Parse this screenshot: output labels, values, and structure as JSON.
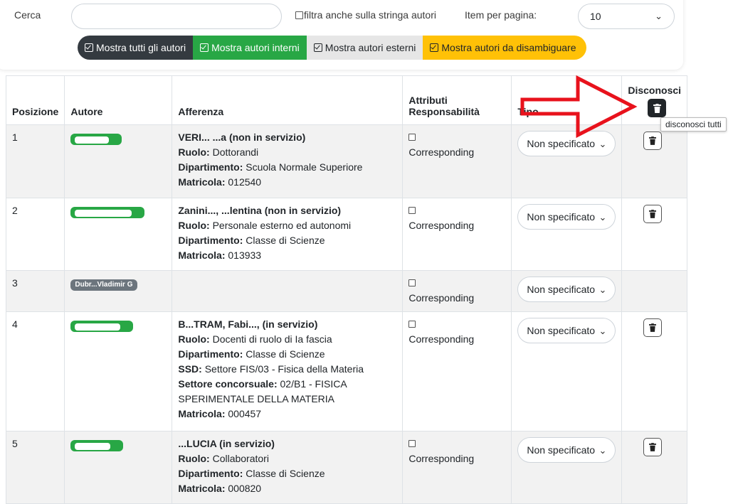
{
  "search": {
    "label": "Cerca",
    "value": "",
    "placeholder": ""
  },
  "filter_authors_string": {
    "label": "filtra anche sulla stringa autori",
    "checked": false
  },
  "items_per_page": {
    "label": "Item per pagina:",
    "value": "10"
  },
  "toggles": [
    {
      "label": "Mostra tutti gli autori",
      "color": "#343a40"
    },
    {
      "label": "Mostra autori interni",
      "color": "#28a745"
    },
    {
      "label": "Mostra autori esterni",
      "color": "#e6e6e6"
    },
    {
      "label": "Mostra autori da disambiguare",
      "color": "#ffc107"
    }
  ],
  "columns": {
    "position": "Posizione",
    "author": "Autore",
    "affiliation": "Afferenza",
    "attributes": "Attributi Responsabilità",
    "type": "Tipo",
    "disown": "Disconosci"
  },
  "tooltip": "disconosci tutti",
  "rows": [
    {
      "position": "1",
      "author_visible": "",
      "name": "VERI... ...a (non in servizio)",
      "ruolo_label": "Ruolo:",
      "ruolo": "Dottorandi",
      "dip_label": "Dipartimento:",
      "dip": "Scuola Normale Superiore",
      "matr_label": "Matricola:",
      "matr": "012540",
      "attribute": "Corresponding",
      "type": "Non specificato"
    },
    {
      "position": "2",
      "author_visible": "",
      "name": "Zanini..., ...lentina (non in servizio)",
      "ruolo_label": "Ruolo:",
      "ruolo": "Personale esterno ed autonomi",
      "dip_label": "Dipartimento:",
      "dip": "Classe di Scienze",
      "matr_label": "Matricola:",
      "matr": "013933",
      "attribute": "Corresponding",
      "type": "Non specificato"
    },
    {
      "position": "3",
      "author_visible": "Dubr...Vladimir G",
      "attribute": "Corresponding",
      "type": "Non specificato"
    },
    {
      "position": "4",
      "author_visible": "",
      "name": "B...TRAM, Fabi..., (in servizio)",
      "ruolo_label": "Ruolo:",
      "ruolo": "Docenti di ruolo di Ia fascia",
      "dip_label": "Dipartimento:",
      "dip": "Classe di Scienze",
      "ssd_label": "SSD:",
      "ssd": "Settore FIS/03 - Fisica della Materia",
      "sc_label": "Settore concorsuale:",
      "sc": "02/B1 - FISICA SPERIMENTALE DELLA MATERIA",
      "matr_label": "Matricola:",
      "matr": "000457",
      "attribute": "Corresponding",
      "type": "Non specificato"
    },
    {
      "position": "5",
      "author_visible": "",
      "name": "...LUCIA (in servizio)",
      "ruolo_label": "Ruolo:",
      "ruolo": "Collaboratori",
      "dip_label": "Dipartimento:",
      "dip": "Classe di Scienze",
      "matr_label": "Matricola:",
      "matr": "000820",
      "attribute": "Corresponding",
      "type": "Non specificato"
    }
  ]
}
